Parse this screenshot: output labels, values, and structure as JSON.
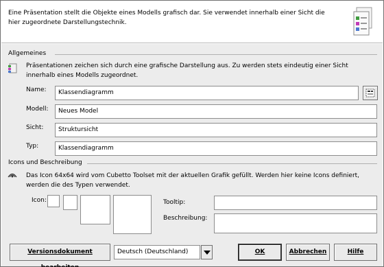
{
  "header": {
    "text": "Eine Präsentation stellt die Objekte eines Modells grafisch dar. Sie verwendet innerhalb einer Sicht die hier zugeordnete Darstellungstechnik.",
    "icon": "presentation-document-icon"
  },
  "general": {
    "title": "Allgemeines",
    "info": "Präsentationen zeichen sich durch eine grafische Darstellung aus. Zu werden stets eindeutig einer Sicht innerhalb eines Modells zugeordnet.",
    "info_icon": "presentation-small-icon",
    "fields": {
      "name_label": "Name:",
      "name_value": "Klassendiagramm",
      "model_label": "Modell:",
      "model_value": "Neues Model",
      "view_label": "Sicht:",
      "view_value": "Struktursicht",
      "type_label": "Typ:",
      "type_value": "Klassendiagramm"
    },
    "name_edit_icon": "text-edit-icon"
  },
  "icons_section": {
    "title": "Icons und Beschreibung",
    "info": "Das Icon 64x64 wird vom Cubetto Toolset mit der aktuellen Grafik gefüllt. Werden hier keine Icons definiert, werden die des Typen verwendet.",
    "info_icon": "eye-icon",
    "icon_label": "Icon:",
    "tooltip_label": "Tooltip:",
    "tooltip_value": "",
    "description_label": "Beschreibung:",
    "description_value": ""
  },
  "footer": {
    "version_button": "Versionsdokument bearbeiten",
    "language_selected": "Deutsch (Deutschland)",
    "ok_button": "OK",
    "cancel_button": "Abbrechen",
    "help_button": "Hilfe"
  }
}
